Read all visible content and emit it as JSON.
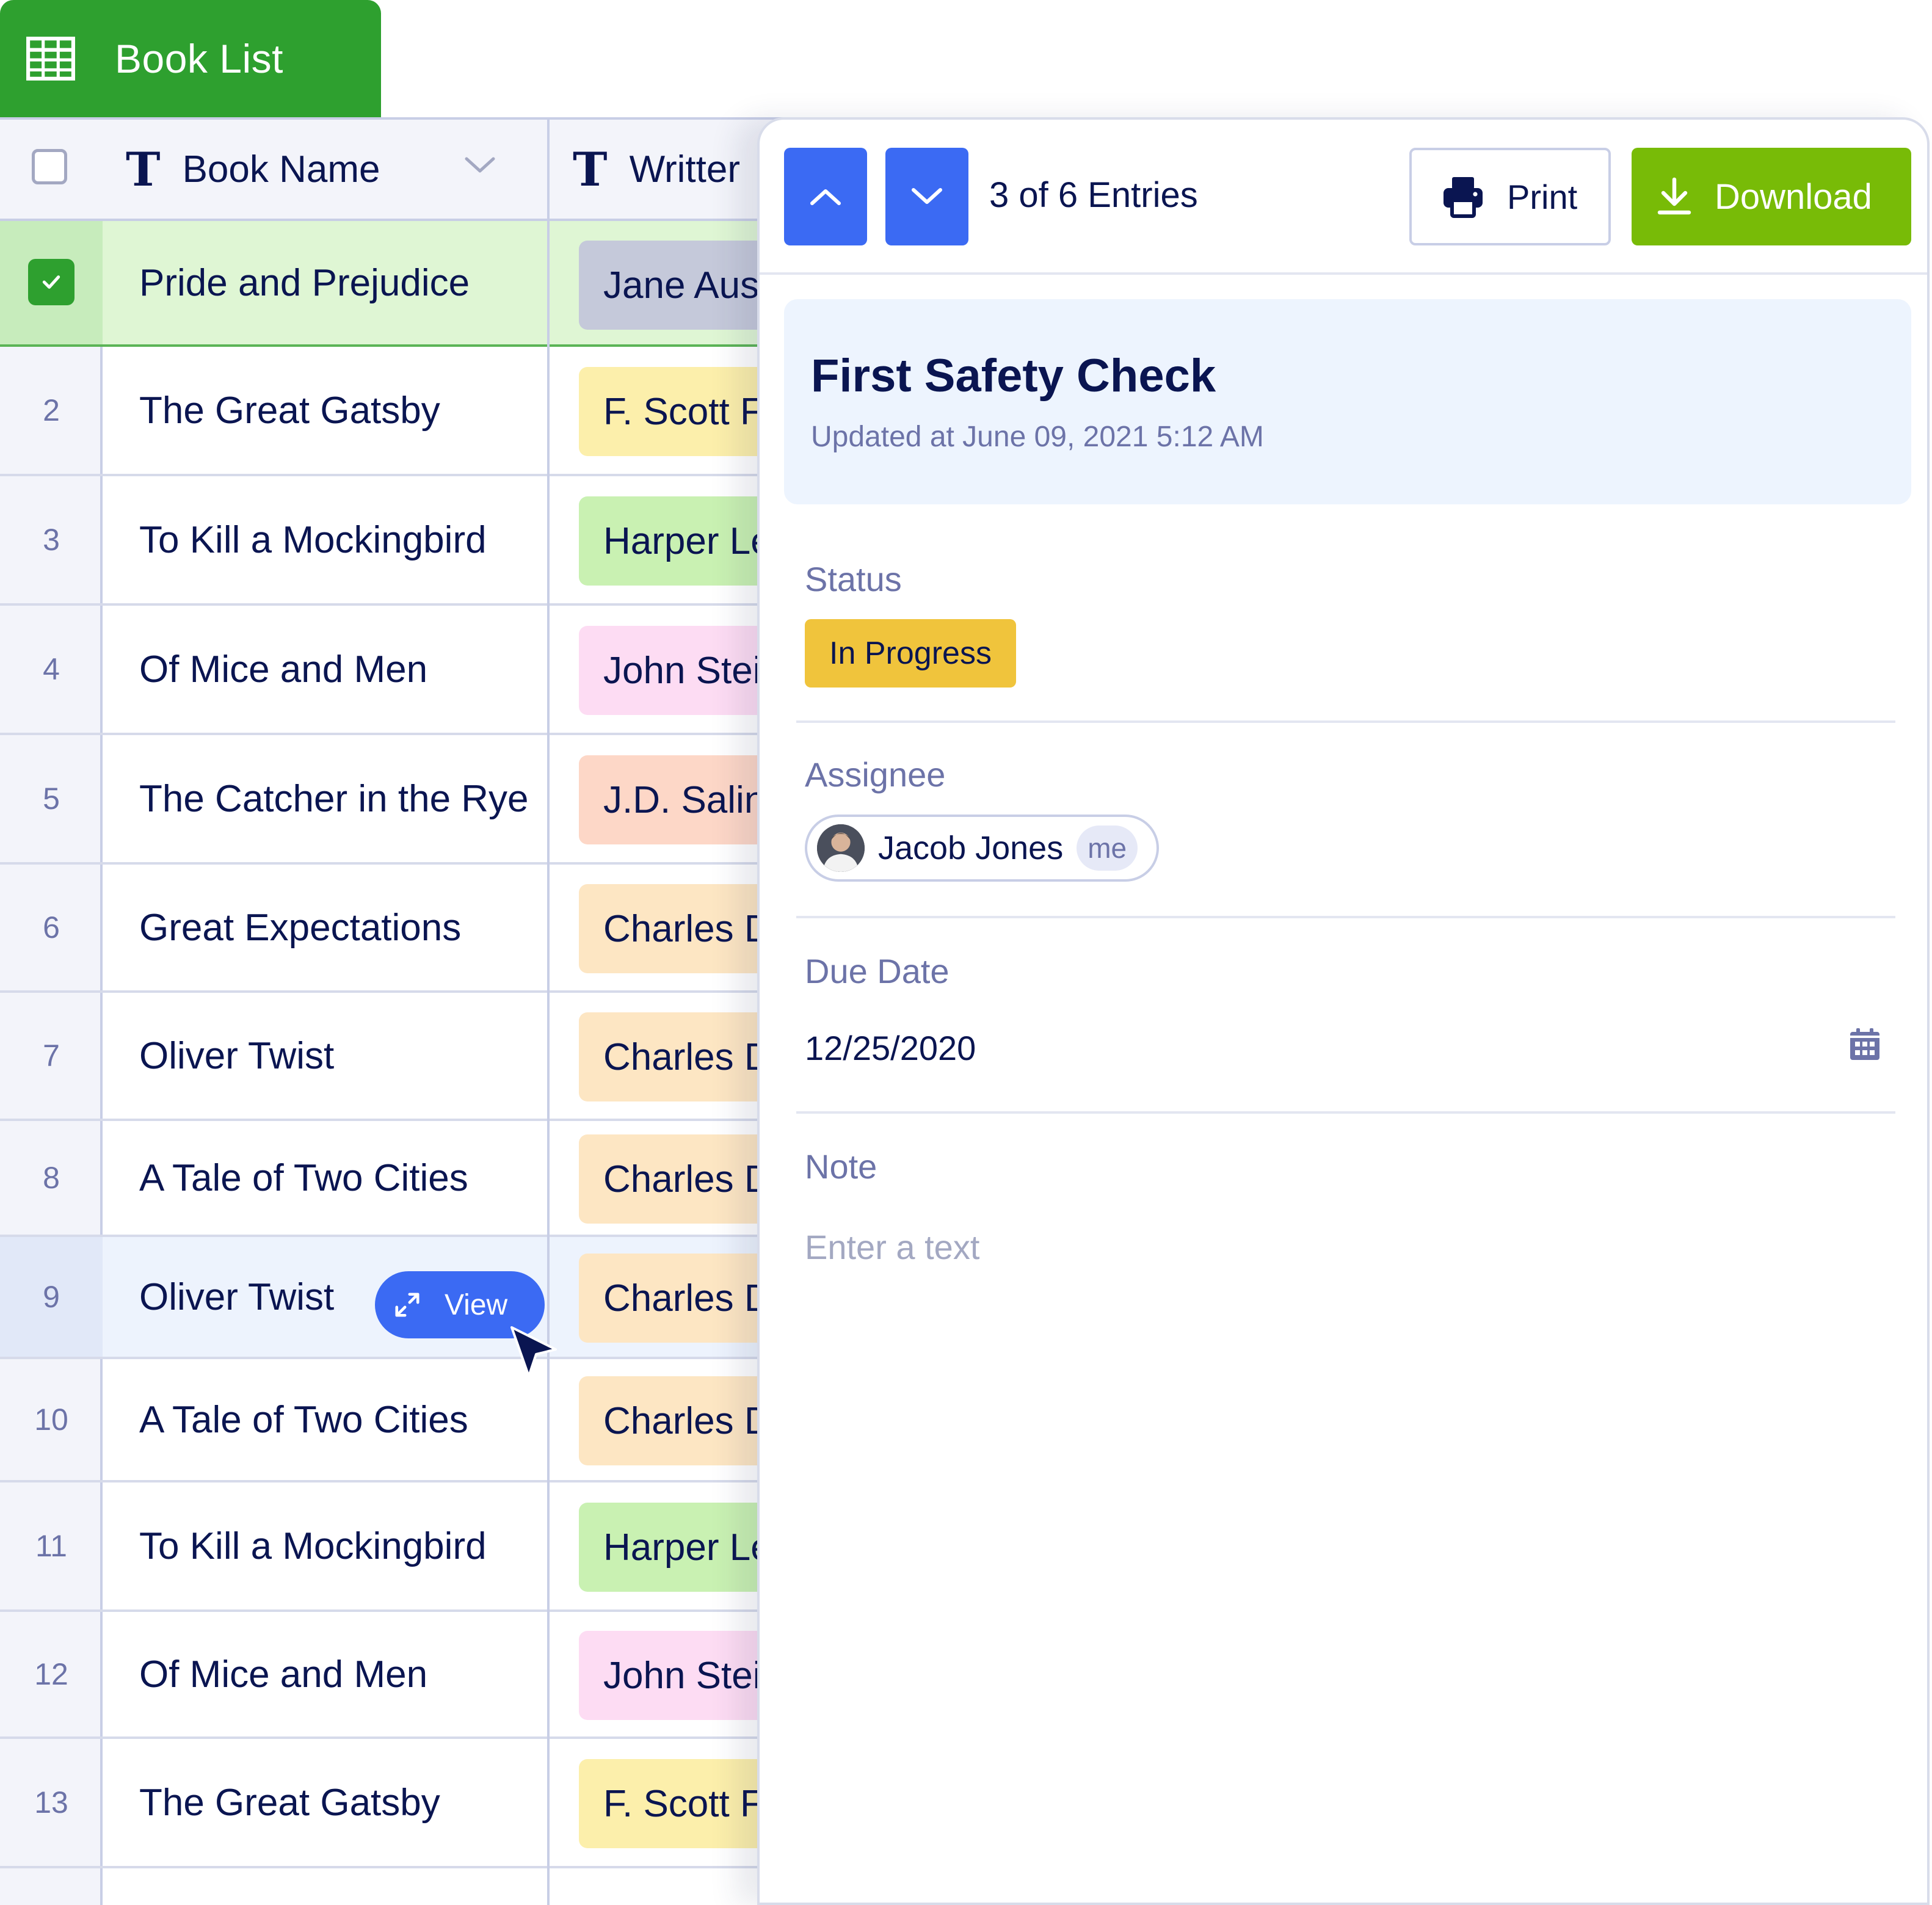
{
  "tab": {
    "title": "Book List",
    "icon": "table-grid-icon"
  },
  "table": {
    "columns": [
      {
        "label": "Book Name",
        "type_icon": "T"
      },
      {
        "label": "Writter",
        "type_icon": "T"
      }
    ],
    "rows": [
      {
        "num": "",
        "name": "Pride and Prejudice",
        "writer": "Jane Austen",
        "chip_color": "#c5c9da",
        "selected": true
      },
      {
        "num": "2",
        "name": "The Great Gatsby",
        "writer": "F. Scott Fitzgerald",
        "chip_color": "#fcefab"
      },
      {
        "num": "3",
        "name": "To Kill a Mockingbird",
        "writer": "Harper Lee",
        "chip_color": "#c9f1b2"
      },
      {
        "num": "4",
        "name": "Of Mice and Men",
        "writer": "John Steinbeck",
        "chip_color": "#fddcf3"
      },
      {
        "num": "5",
        "name": "The Catcher in the Rye",
        "writer": "J.D. Salinger",
        "chip_color": "#fdd7c7"
      },
      {
        "num": "6",
        "name": "Great Expectations",
        "writer": "Charles Dickens",
        "chip_color": "#fde6c3"
      },
      {
        "num": "7",
        "name": "Oliver Twist",
        "writer": "Charles Dickens",
        "chip_color": "#fde6c3"
      },
      {
        "num": "8",
        "name": "A Tale of Two Cities",
        "writer": "Charles Dickens",
        "chip_color": "#fde6c3"
      },
      {
        "num": "9",
        "name": "Oliver Twist",
        "writer": "Charles Dickens",
        "chip_color": "#fde6c3",
        "hover": true
      },
      {
        "num": "10",
        "name": "A Tale of Two Cities",
        "writer": "Charles Dickens",
        "chip_color": "#fde6c3"
      },
      {
        "num": "11",
        "name": "To Kill a Mockingbird",
        "writer": "Harper Lee",
        "chip_color": "#c9f1b2"
      },
      {
        "num": "12",
        "name": "Of Mice and Men",
        "writer": "John Steinbeck",
        "chip_color": "#fddcf3"
      },
      {
        "num": "13",
        "name": "The Great Gatsby",
        "writer": "F. Scott Fitzgerald",
        "chip_color": "#fcefab"
      }
    ],
    "view_button": "View"
  },
  "panel": {
    "entries": "3 of 6 Entries",
    "print_label": "Print",
    "download_label": "Download",
    "card": {
      "title": "First Safety Check",
      "updated": "Updated at June 09, 2021 5:12 AM"
    },
    "status": {
      "label": "Status",
      "value": "In Progress",
      "color": "#f0c43c"
    },
    "assignee": {
      "label": "Assignee",
      "name": "Jacob Jones",
      "badge": "me"
    },
    "due_date": {
      "label": "Due Date",
      "value": "12/25/2020"
    },
    "note": {
      "label": "Note",
      "placeholder": "Enter a text"
    }
  },
  "colors": {
    "brand_green": "#2ea02f",
    "accent_blue": "#3b6af3",
    "download_green": "#78bb07",
    "text_navy": "#0a1551"
  }
}
